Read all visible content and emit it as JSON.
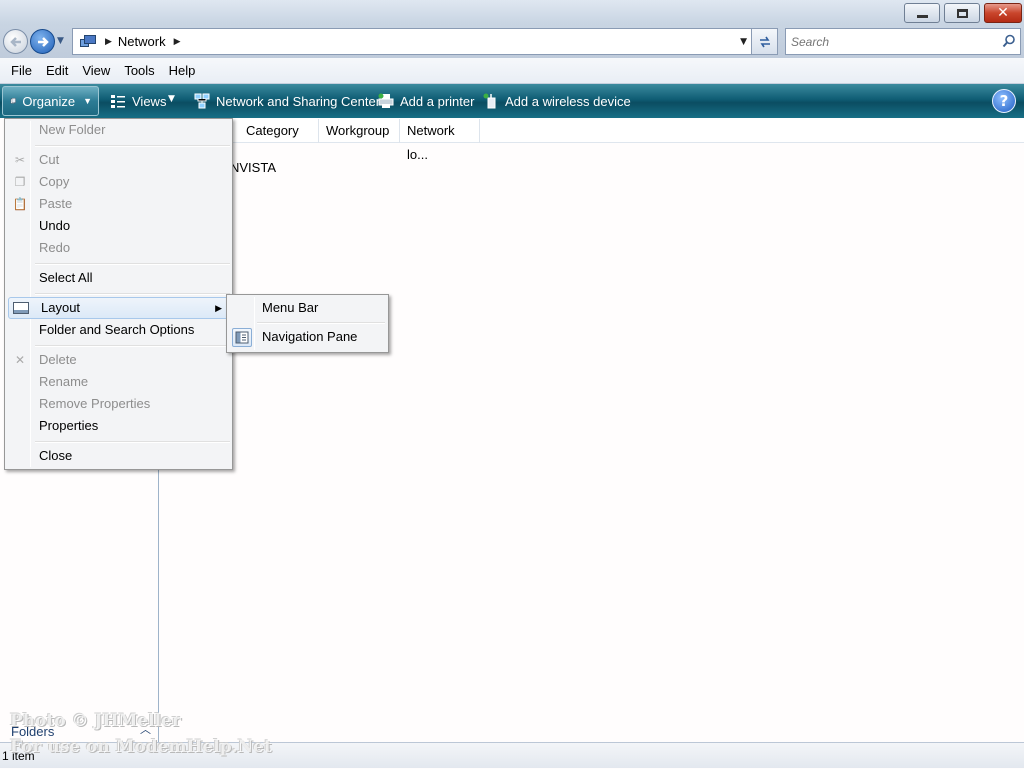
{
  "window": {
    "buttons": {
      "minimize": "minimize",
      "maximize": "restore",
      "close": "✕"
    }
  },
  "address": {
    "breadcrumb": [
      "Network"
    ],
    "search_placeholder": "Search"
  },
  "menubar": {
    "items": [
      "File",
      "Edit",
      "View",
      "Tools",
      "Help"
    ]
  },
  "commandbar": {
    "organize": "Organize",
    "views": "Views",
    "network_sharing": "Network and Sharing Center",
    "add_printer": "Add a printer",
    "add_wireless": "Add a wireless device",
    "help": "?"
  },
  "columns": {
    "headers": [
      "Category",
      "Workgroup",
      "Network lo..."
    ]
  },
  "content": {
    "item_visible_text": "NVISTA"
  },
  "organize_menu": {
    "new_folder": "New Folder",
    "cut": "Cut",
    "copy": "Copy",
    "paste": "Paste",
    "undo": "Undo",
    "redo": "Redo",
    "select_all": "Select All",
    "layout": "Layout",
    "folder_options": "Folder and Search Options",
    "delete": "Delete",
    "rename": "Rename",
    "remove_properties": "Remove Properties",
    "properties": "Properties",
    "close": "Close"
  },
  "layout_submenu": {
    "menu_bar": "Menu Bar",
    "navigation_pane": "Navigation Pane",
    "navigation_pane_checked": true
  },
  "nav_pane": {
    "folders_label": "Folders"
  },
  "status": {
    "item_count": "1 item"
  },
  "watermark": {
    "line1": "Photo © JHMeller",
    "line2": "For use on ModemHelp.Net"
  },
  "colors": {
    "commandbar": "#0f5d74",
    "menu_highlight": "#dce9f7",
    "disabled_text": "#8d8d8d"
  }
}
